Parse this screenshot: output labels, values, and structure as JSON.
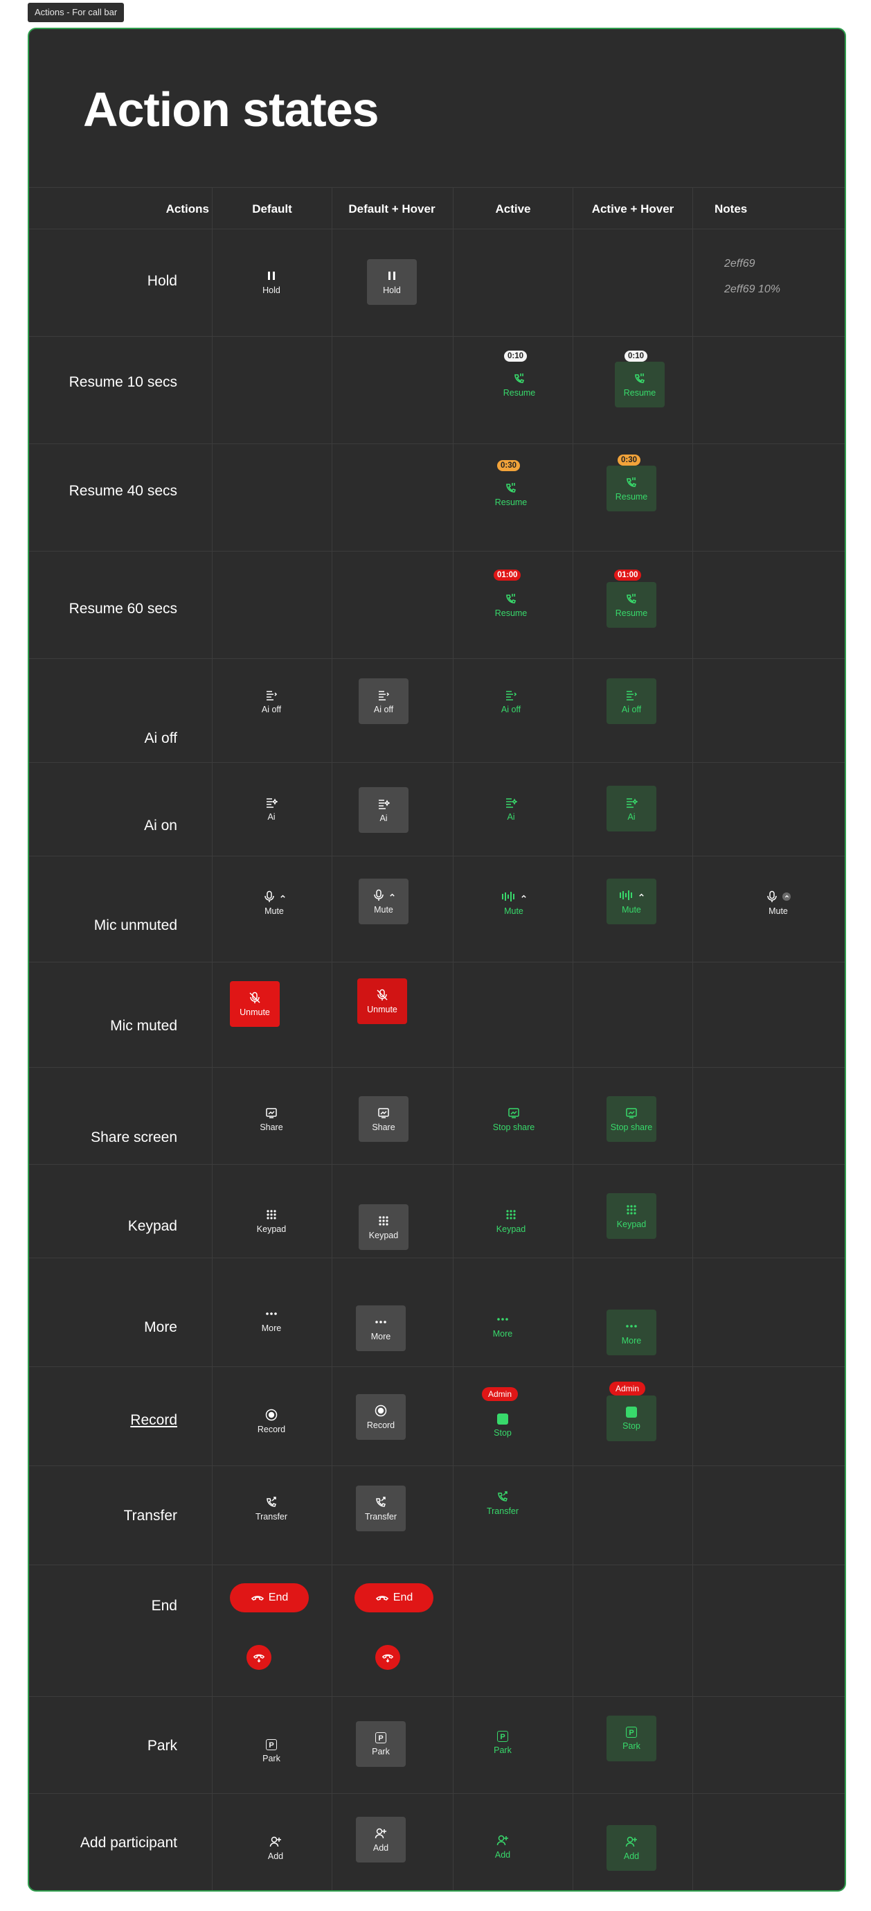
{
  "frame_label": "Actions - For call bar",
  "title": "Action states",
  "columns": {
    "actions": "Actions",
    "default": "Default",
    "default_hover": "Default + Hover",
    "active": "Active",
    "active_hover": "Active + Hover",
    "notes": "Notes"
  },
  "rows": {
    "hold": {
      "label": "Hold",
      "btn": "Hold",
      "note1": "2eff69",
      "note2": "2eff69 10%"
    },
    "resume10": {
      "label": "Resume 10 secs",
      "btn": "Resume",
      "timer": "0:10"
    },
    "resume40": {
      "label": "Resume 40 secs",
      "btn": "Resume",
      "timer": "0:30"
    },
    "resume60": {
      "label": "Resume 60 secs",
      "btn": "Resume",
      "timer": "01:00"
    },
    "aioff": {
      "label": "Ai off",
      "btn": "Ai off"
    },
    "aion": {
      "label": "Ai on",
      "btn": "Ai"
    },
    "mic_unmuted": {
      "label": "Mic unmuted",
      "btn": "Mute"
    },
    "mic_muted": {
      "label": "Mic muted",
      "btn": "Unmute"
    },
    "share": {
      "label": "Share screen",
      "btn": "Share",
      "active_btn": "Stop share"
    },
    "keypad": {
      "label": "Keypad",
      "btn": "Keypad"
    },
    "more": {
      "label": "More",
      "btn": "More"
    },
    "record": {
      "label": "Record",
      "btn": "Record",
      "active_btn": "Stop",
      "badge": "Admin"
    },
    "transfer": {
      "label": "Transfer",
      "btn": "Transfer"
    },
    "end": {
      "label": "End",
      "btn": "End"
    },
    "park": {
      "label": "Park",
      "btn": "Park",
      "glyph": "P"
    },
    "add": {
      "label": "Add participant",
      "btn": "Add"
    }
  },
  "colors": {
    "accent_green": "#38d96b",
    "green_hover_bg": "#2f4a34",
    "danger_red": "#e01616",
    "timer_orange": "#f2a33a",
    "board_bg": "#2c2c2c",
    "hover_bg": "#4a4a4a"
  }
}
